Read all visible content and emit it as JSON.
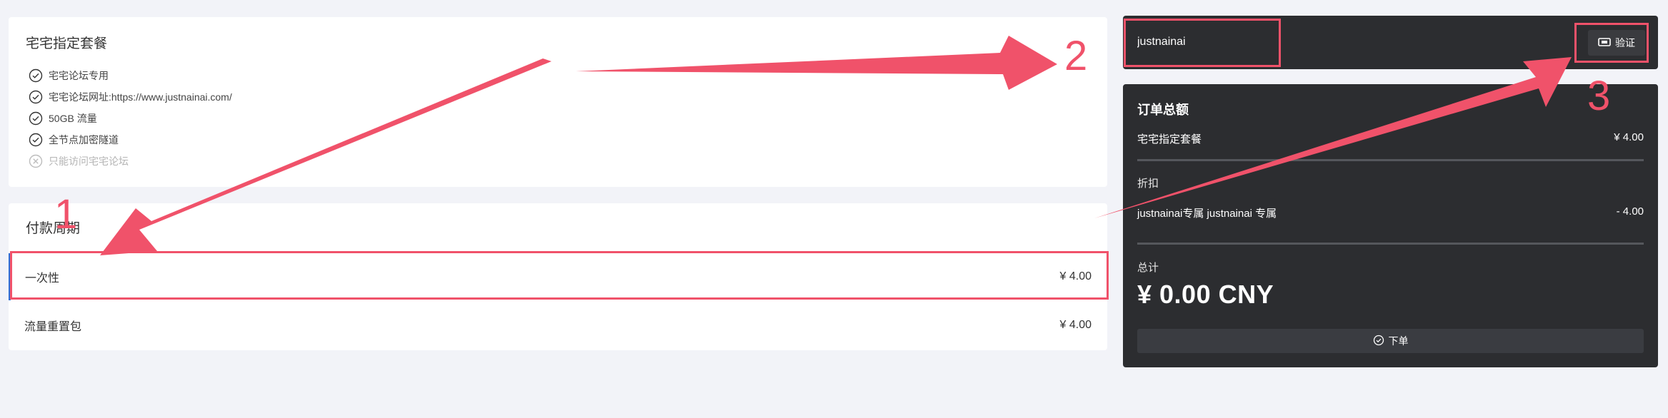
{
  "plan": {
    "title": "宅宅指定套餐",
    "features": [
      {
        "text": "宅宅论坛专用",
        "enabled": true
      },
      {
        "text": "宅宅论坛网址:https://www.justnainai.com/",
        "enabled": true
      },
      {
        "text": "50GB 流量",
        "enabled": true
      },
      {
        "text": "全节点加密隧道",
        "enabled": true
      },
      {
        "text": "只能访问宅宅论坛",
        "enabled": false
      }
    ]
  },
  "payment": {
    "title": "付款周期",
    "options": [
      {
        "label": "一次性",
        "price": "¥ 4.00",
        "selected": true
      },
      {
        "label": "流量重置包",
        "price": "¥ 4.00",
        "selected": false
      }
    ]
  },
  "coupon": {
    "value": "justnainai",
    "verify_label": "验证"
  },
  "summary": {
    "title": "订单总额",
    "item_label": "宅宅指定套餐",
    "item_price": "¥ 4.00",
    "discount_label": "折扣",
    "discount_name": "justnainai专属  justnainai 专属",
    "discount_value": "- 4.00",
    "total_label": "总计",
    "total_value": "¥ 0.00 CNY",
    "order_label": "下单"
  },
  "annotations": {
    "labels": [
      "1",
      "2",
      "3"
    ],
    "color": "#f0526a"
  },
  "colors": {
    "page_bg": "#f2f3f8",
    "dark_panel": "#2c2d30",
    "selected_accent": "#2f6fd6"
  }
}
